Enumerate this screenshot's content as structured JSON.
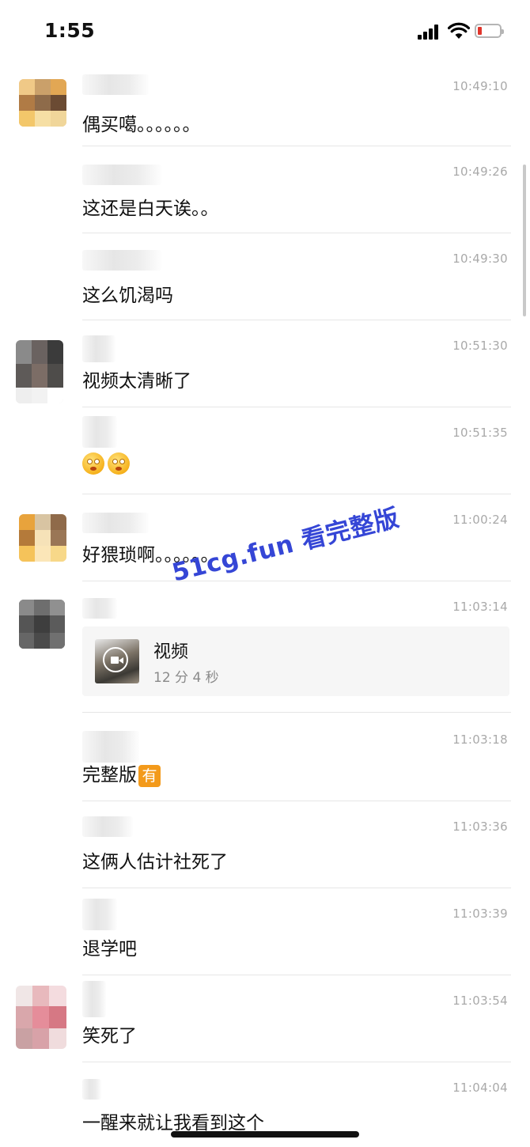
{
  "status_bar": {
    "time": "1:55"
  },
  "watermark": "51cg.fun 看完整版",
  "messages": [
    {
      "time": "10:49:10",
      "text": "偶买噶。。。。。。"
    },
    {
      "time": "10:49:26",
      "text": "这还是白天诶。。"
    },
    {
      "time": "10:49:30",
      "text": "这么饥渴吗"
    },
    {
      "time": "10:51:30",
      "text": "视频太清晰了"
    },
    {
      "time": "10:51:35",
      "text": ""
    },
    {
      "time": "11:00:24",
      "text": "好猥琐啊。。。。。。"
    },
    {
      "time": "11:03:14",
      "video": {
        "title": "视频",
        "duration": "12 分 4 秒"
      }
    },
    {
      "time": "11:03:18",
      "text": "完整版",
      "badge": "有"
    },
    {
      "time": "11:03:36",
      "text": "这俩人估计社死了"
    },
    {
      "time": "11:03:39",
      "text": "退学吧"
    },
    {
      "time": "11:03:54",
      "text": "笑死了"
    },
    {
      "time": "11:04:04",
      "text": "一醒来就让我看到这个"
    }
  ],
  "colors": {
    "timestamp": "#a9a9a9",
    "watermark": "#3546d6",
    "badge": "#f39a1b",
    "battery_low": "#e0352b"
  }
}
